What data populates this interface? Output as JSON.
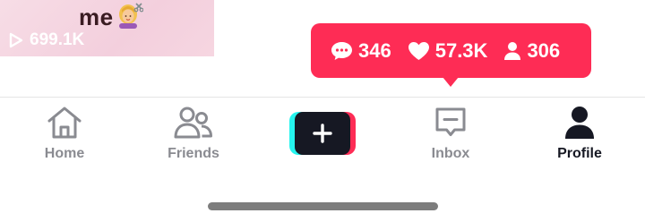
{
  "video": {
    "caption": "me",
    "caption_emoji": "woman-getting-haircut-emoji",
    "views": "699.1K"
  },
  "stats_bubble": {
    "comments": "346",
    "likes": "57.3K",
    "followers": "306",
    "color": "#fe2c55"
  },
  "tabs": [
    {
      "label": "Home",
      "icon": "home-icon",
      "active": false
    },
    {
      "label": "Friends",
      "icon": "friends-icon",
      "active": false
    },
    {
      "label": "",
      "icon": "plus-icon",
      "active": false
    },
    {
      "label": "Inbox",
      "icon": "inbox-icon",
      "active": false
    },
    {
      "label": "Profile",
      "icon": "profile-icon",
      "active": true
    }
  ],
  "colors": {
    "accent_pink": "#fe2c55",
    "accent_cyan": "#25f4ee",
    "inactive_tab": "#8a8b91",
    "active_tab": "#161823"
  }
}
